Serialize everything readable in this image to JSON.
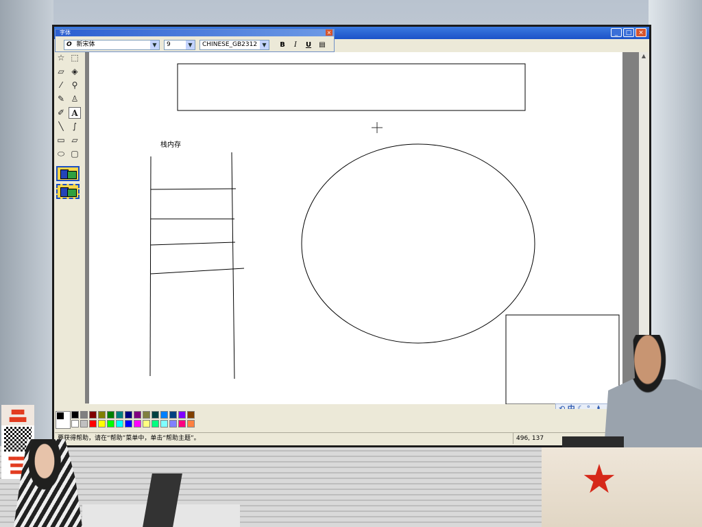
{
  "fontbar": {
    "title": "字体",
    "font_name": "新宋体",
    "font_size": "9",
    "charset": "CHINESE_GB2312",
    "bold_label": "B",
    "italic_label": "I",
    "underline_label": "U",
    "close_label": "×"
  },
  "window": {
    "minimize_label": "_",
    "maximize_label": "□",
    "close_label": "×"
  },
  "canvas": {
    "stack_label": "栈内存"
  },
  "statusbar": {
    "help_text": "要获得帮助，请在“帮助”菜单中，单击“帮助主题”。",
    "coords": "496, 137"
  },
  "ime": {
    "label": "中"
  },
  "palette": {
    "row1": [
      "#000000",
      "#808080",
      "#800000",
      "#808000",
      "#008000",
      "#008080",
      "#000080",
      "#800080",
      "#808040",
      "#004040",
      "#0080ff",
      "#004080",
      "#8000ff",
      "#804000"
    ],
    "row2": [
      "#ffffff",
      "#c0c0c0",
      "#ff0000",
      "#ffff00",
      "#00ff00",
      "#00ffff",
      "#0000ff",
      "#ff00ff",
      "#ffff80",
      "#00ff80",
      "#80ffff",
      "#8080ff",
      "#ff0080",
      "#ff8040"
    ]
  },
  "tools": [
    "free-select",
    "rect-select",
    "eraser",
    "fill",
    "color-picker",
    "magnifier",
    "pencil",
    "brush",
    "airbrush",
    "text",
    "line",
    "curve",
    "rectangle",
    "polygon",
    "ellipse",
    "rounded-rect"
  ]
}
